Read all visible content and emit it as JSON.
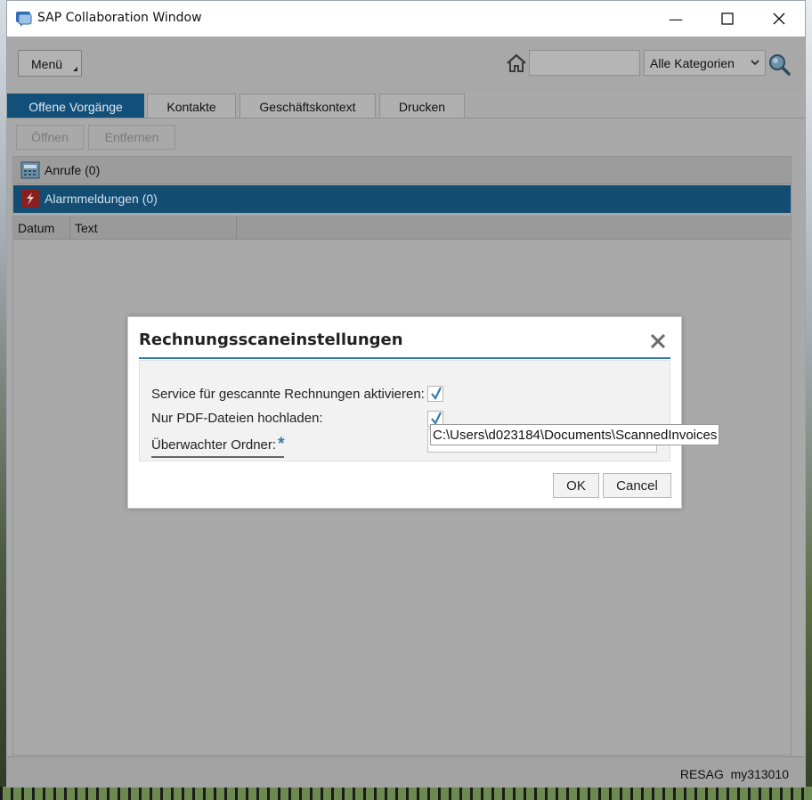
{
  "window": {
    "title": "SAP Collaboration Window",
    "minimize_glyph": "—",
    "maximize_glyph": "☐",
    "close_glyph": "✕"
  },
  "toolbar": {
    "menu_label": "Menü",
    "search_value": "",
    "category_selected": "Alle Kategorien"
  },
  "tabs": [
    {
      "label": "Offene Vorgänge",
      "active": true
    },
    {
      "label": "Kontakte",
      "active": false
    },
    {
      "label": "Geschäftskontext",
      "active": false
    },
    {
      "label": "Drucken",
      "active": false
    }
  ],
  "actions": {
    "open_label": "Öffnen",
    "remove_label": "Entfernen"
  },
  "categories": [
    {
      "label": "Anrufe (0)",
      "icon": "phone-icon",
      "selected": false
    },
    {
      "label": "Alarmmeldungen (0)",
      "icon": "alarm-icon",
      "selected": true
    }
  ],
  "grid": {
    "columns": [
      "Datum",
      "Text"
    ]
  },
  "status": {
    "text": "RESAG  my313010"
  },
  "dialog": {
    "title": "Rechnungsscaneinstellungen",
    "service_label": "Service für gescannte Rechnungen aktivieren:",
    "service_checked": true,
    "pdf_label": "Nur PDF-Dateien hochladen:",
    "pdf_checked": true,
    "folder_label": "Überwachter Ordner:",
    "required_marker": "*",
    "folder_value": "C:\\Users\\d023184\\Documents\\ScannedInvoices",
    "ok_label": "OK",
    "cancel_label": "Cancel"
  },
  "colors": {
    "accent": "#12507a",
    "dialog_rule": "#2d7ea8"
  }
}
